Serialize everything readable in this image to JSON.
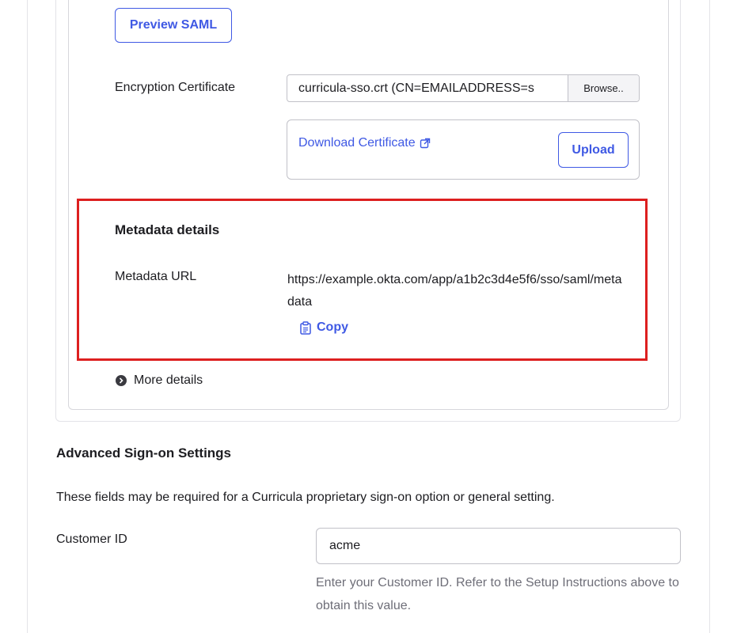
{
  "saml": {
    "preview_button": "Preview SAML",
    "encryption_label": "Encryption Certificate",
    "file_value": "curricula-sso.crt (CN=EMAILADDRESS=s",
    "browse_button": "Browse..",
    "download_link": "Download Certificate",
    "upload_button": "Upload"
  },
  "metadata": {
    "title": "Metadata details",
    "url_label": "Metadata URL",
    "url_value": "https://example.okta.com/app/a1b2c3d4e5f6/sso/saml/metadata",
    "copy_label": "Copy"
  },
  "more_details": "More details",
  "advanced": {
    "title": "Advanced Sign-on Settings",
    "description": "These fields may be required for a Curricula proprietary sign-on option or general setting.",
    "customer_id_label": "Customer ID",
    "customer_id_value": "acme",
    "customer_id_help": "Enter your Customer ID. Refer to the Setup Instructions above to obtain this value."
  },
  "colors": {
    "accent": "#3f59e4",
    "highlight_border": "#dd1f1f",
    "text": "#1d1d21",
    "muted_text": "#6e6e78"
  },
  "icons": {
    "external_link": "external-link-icon",
    "copy": "clipboard-icon",
    "more_details": "chevron-right-circle-icon"
  }
}
